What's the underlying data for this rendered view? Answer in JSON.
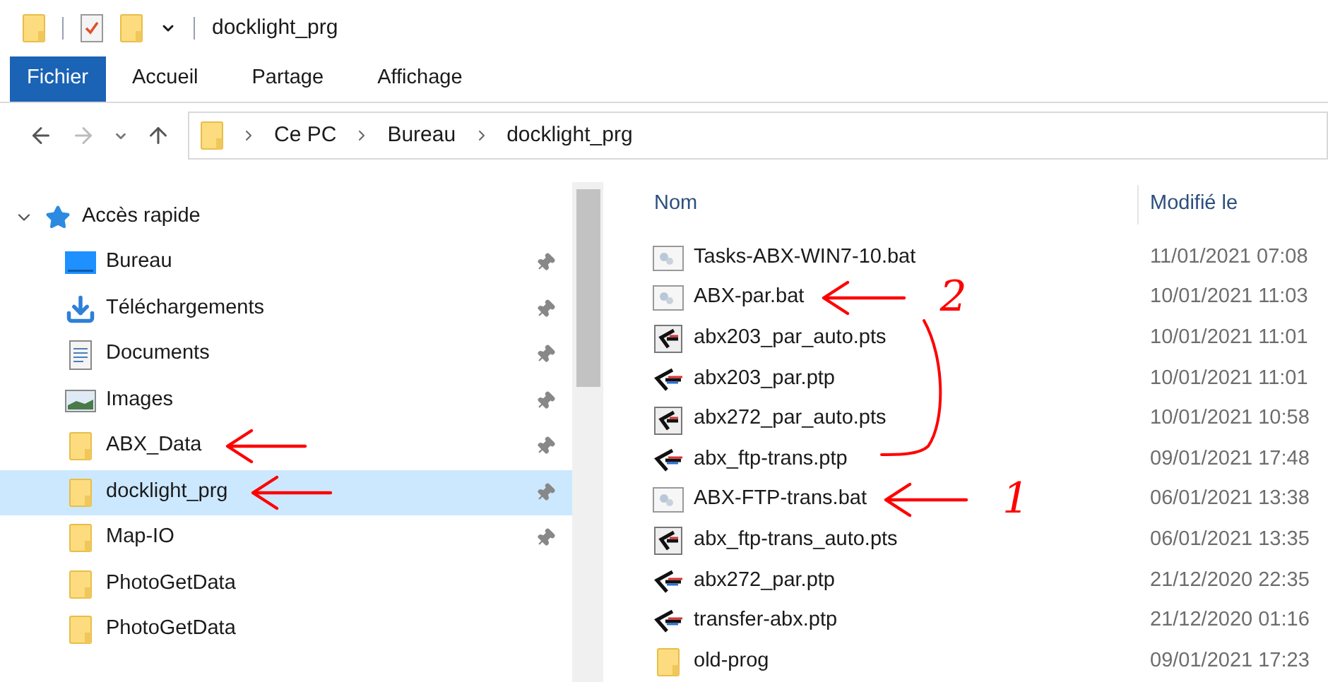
{
  "window": {
    "title": "docklight_prg"
  },
  "ribbon_tabs": [
    {
      "label": "Fichier",
      "selected": true
    },
    {
      "label": "Accueil",
      "selected": false
    },
    {
      "label": "Partage",
      "selected": false
    },
    {
      "label": "Affichage",
      "selected": false
    }
  ],
  "breadcrumb": [
    "Ce PC",
    "Bureau",
    "docklight_prg"
  ],
  "sidebar": {
    "header": {
      "label": "Accès rapide",
      "expanded": true
    },
    "items": [
      {
        "label": "Bureau",
        "kind": "desktop",
        "pinned": true,
        "selected": false,
        "arrow": false
      },
      {
        "label": "Téléchargements",
        "kind": "download",
        "pinned": true,
        "selected": false,
        "arrow": false
      },
      {
        "label": "Documents",
        "kind": "document",
        "pinned": true,
        "selected": false,
        "arrow": false
      },
      {
        "label": "Images",
        "kind": "image",
        "pinned": true,
        "selected": false,
        "arrow": false
      },
      {
        "label": "ABX_Data",
        "kind": "folder",
        "pinned": true,
        "selected": false,
        "arrow": true
      },
      {
        "label": "docklight_prg",
        "kind": "folder",
        "pinned": true,
        "selected": true,
        "arrow": true
      },
      {
        "label": "Map-IO",
        "kind": "folder",
        "pinned": true,
        "selected": false,
        "arrow": false
      },
      {
        "label": "PhotoGetData",
        "kind": "folder",
        "pinned": false,
        "selected": false,
        "arrow": false
      },
      {
        "label": "PhotoGetData",
        "kind": "folder",
        "pinned": false,
        "selected": false,
        "arrow": false
      }
    ]
  },
  "table": {
    "columns": [
      "Nom",
      "Modifié le"
    ],
    "rows": [
      {
        "name": "Tasks-ABX-WIN7-10.bat",
        "modified": "11/01/2021 07:08",
        "kind": "bat",
        "arrow": false
      },
      {
        "name": "ABX-par.bat",
        "modified": "10/01/2021 11:03",
        "kind": "bat",
        "arrow": true,
        "number": "2"
      },
      {
        "name": "abx203_par_auto.pts",
        "modified": "10/01/2021 11:01",
        "kind": "pts",
        "arrow": false
      },
      {
        "name": "abx203_par.ptp",
        "modified": "10/01/2021 11:01",
        "kind": "ptp",
        "arrow": false
      },
      {
        "name": "abx272_par_auto.pts",
        "modified": "10/01/2021 10:58",
        "kind": "pts",
        "arrow": false
      },
      {
        "name": "abx_ftp-trans.ptp",
        "modified": "09/01/2021 17:48",
        "kind": "ptp",
        "arrow": false
      },
      {
        "name": "ABX-FTP-trans.bat",
        "modified": "06/01/2021 13:38",
        "kind": "bat",
        "arrow": true,
        "number": "1"
      },
      {
        "name": "abx_ftp-trans_auto.pts",
        "modified": "06/01/2021 13:35",
        "kind": "pts",
        "arrow": false
      },
      {
        "name": "abx272_par.ptp",
        "modified": "21/12/2020 22:35",
        "kind": "ptp",
        "arrow": false
      },
      {
        "name": "transfer-abx.ptp",
        "modified": "21/12/2020 01:16",
        "kind": "ptp",
        "arrow": false
      },
      {
        "name": "old-prog",
        "modified": "09/01/2021 17:23",
        "kind": "folder",
        "arrow": false
      }
    ],
    "bracket": true
  }
}
